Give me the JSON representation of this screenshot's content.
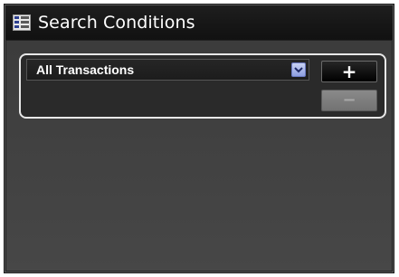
{
  "window": {
    "title": "Search Conditions",
    "title_icon": "list-icon"
  },
  "condition": {
    "selected_value": "All Transactions",
    "dropdown_icon": "chevron-down-icon"
  },
  "buttons": {
    "add_label": "+",
    "remove_label": "−",
    "remove_enabled": false
  },
  "colors": {
    "window_bg": "#3a3a3a",
    "titlebar_bg": "#111111",
    "panel_border": "#e8e8e8",
    "dropdown_accent": "#8d9ee0",
    "remove_disabled": "#7e7e7e"
  }
}
